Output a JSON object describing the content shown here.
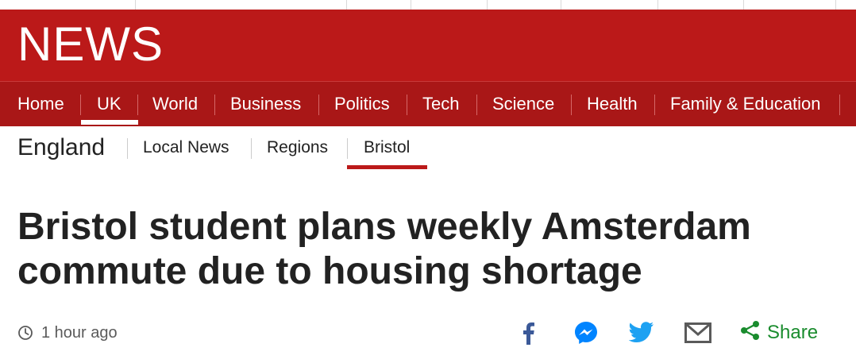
{
  "brand": {
    "logo_text": "NEWS",
    "primary_red": "#bb1919",
    "nav_red": "#a91717"
  },
  "nav": {
    "items": [
      {
        "label": "Home"
      },
      {
        "label": "UK",
        "active": true
      },
      {
        "label": "World"
      },
      {
        "label": "Business"
      },
      {
        "label": "Politics"
      },
      {
        "label": "Tech"
      },
      {
        "label": "Science"
      },
      {
        "label": "Health"
      },
      {
        "label": "Family & Education"
      }
    ]
  },
  "subnav": {
    "section": "England",
    "items": [
      {
        "label": "Local News"
      },
      {
        "label": "Regions"
      },
      {
        "label": "Bristol",
        "active": true
      }
    ]
  },
  "article": {
    "headline": "Bristol student plans weekly Amsterdam commute due to housing shortage",
    "timestamp": "1 hour ago"
  },
  "share": {
    "icons": [
      "facebook-icon",
      "messenger-icon",
      "twitter-icon",
      "email-icon",
      "share-icon"
    ],
    "label": "Share",
    "colors": {
      "facebook": "#3b5998",
      "messenger": "#0084ff",
      "twitter": "#1da1f2",
      "email": "#5a5a5a",
      "share": "#1a8c2e"
    }
  }
}
